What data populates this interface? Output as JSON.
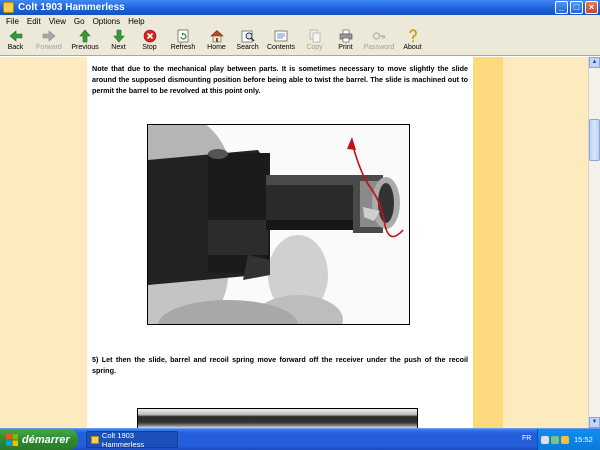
{
  "window": {
    "title": "Colt 1903 Hammerless",
    "controls": [
      "_",
      "□",
      "×"
    ]
  },
  "menu": [
    "File",
    "Edit",
    "View",
    "Go",
    "Options",
    "Help"
  ],
  "toolbar": [
    {
      "label": "Back",
      "icon": "back-arrow-icon",
      "enabled": true
    },
    {
      "label": "Forward",
      "icon": "forward-arrow-icon",
      "enabled": false
    },
    {
      "label": "Previous",
      "icon": "up-arrow-icon",
      "enabled": true
    },
    {
      "label": "Next",
      "icon": "down-arrow-icon",
      "enabled": true
    },
    {
      "label": "Stop",
      "icon": "stop-icon",
      "enabled": true
    },
    {
      "label": "Refresh",
      "icon": "refresh-icon",
      "enabled": true
    },
    {
      "label": "Home",
      "icon": "home-icon",
      "enabled": true
    },
    {
      "label": "Search",
      "icon": "search-icon",
      "enabled": true
    },
    {
      "label": "Contents",
      "icon": "contents-icon",
      "enabled": true
    },
    {
      "label": "Copy",
      "icon": "copy-icon",
      "enabled": false
    },
    {
      "label": "Print",
      "icon": "print-icon",
      "enabled": true
    },
    {
      "label": "Password",
      "icon": "password-icon",
      "enabled": false
    },
    {
      "label": "About",
      "icon": "about-icon",
      "enabled": true
    }
  ],
  "content": {
    "paragraph1": "Note that due to the mechanical play between parts. It is sometimes necessary to move slightly the slide around the supposed dismounting position before being able to twist the barrel. The slide is machined out to permit the barrel to be revolved at this point only.",
    "paragraph2": "5) Let then the slide, barrel and recoil spring move forward off the receiver under the push of the recoil spring."
  },
  "taskbar": {
    "start_label": "démarrer",
    "task_label": "Colt 1903 Hammerless",
    "language": "FR",
    "clock": "15:52"
  },
  "colors": {
    "page_background": "#fdebbf",
    "gold_strip": "#fcd97d",
    "titlebar": "#1d5fd6",
    "taskbar": "#245edb",
    "annotation_red": "#c4101a"
  }
}
